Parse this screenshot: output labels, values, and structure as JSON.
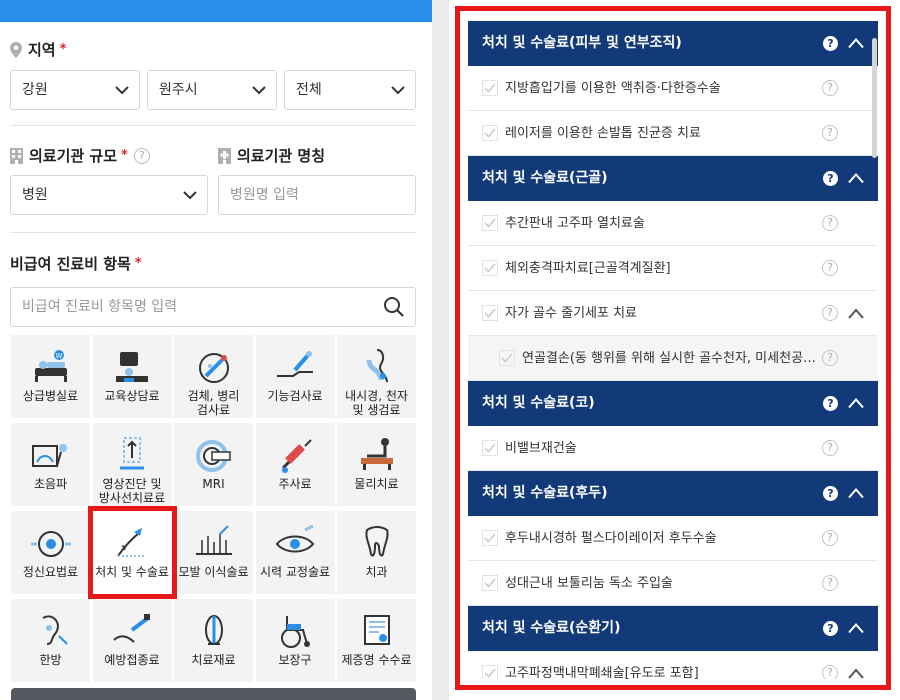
{
  "region": {
    "title": "지역",
    "required_mark": "*",
    "selects": [
      "강원",
      "원주시",
      "전체"
    ]
  },
  "facility": {
    "scale_title": "의료기관 규모",
    "required_mark": "*",
    "scale_value": "병원",
    "name_title": "의료기관 명칭",
    "name_placeholder": "병원명 입력"
  },
  "items": {
    "title": "비급여 진료비 항목",
    "required_mark": "*",
    "search_placeholder": "비급여 진료비 항목명 입력",
    "categories": [
      {
        "label": "상급병실료",
        "icon": "hospital-bed-icon"
      },
      {
        "label": "교육상담료",
        "icon": "consultation-icon"
      },
      {
        "label": "검체, 병리\n검사료",
        "icon": "pathology-test-icon"
      },
      {
        "label": "기능검사료",
        "icon": "function-test-icon"
      },
      {
        "label": "내시경, 천자\n및 생검료",
        "icon": "endoscopy-icon"
      },
      {
        "label": "초음파",
        "icon": "ultrasound-icon"
      },
      {
        "label": "영상진단 및\n방사선치료료",
        "icon": "radiology-icon"
      },
      {
        "label": "MRI",
        "icon": "mri-icon"
      },
      {
        "label": "주사료",
        "icon": "syringe-icon"
      },
      {
        "label": "물리치료",
        "icon": "physical-therapy-icon"
      },
      {
        "label": "정신요법료",
        "icon": "psychotherapy-icon"
      },
      {
        "label": "처치 및 수술료",
        "icon": "surgery-scalpel-icon"
      },
      {
        "label": "모발 이식술료",
        "icon": "hair-transplant-icon"
      },
      {
        "label": "시력 교정술료",
        "icon": "eye-correction-icon"
      },
      {
        "label": "치과",
        "icon": "tooth-icon"
      },
      {
        "label": "한방",
        "icon": "oriental-medicine-icon"
      },
      {
        "label": "예방접종료",
        "icon": "vaccination-icon"
      },
      {
        "label": "치료재료",
        "icon": "treatment-material-icon"
      },
      {
        "label": "보장구",
        "icon": "wheelchair-icon"
      },
      {
        "label": "제증명 수수료",
        "icon": "certificate-icon"
      }
    ],
    "selected_index": 11
  },
  "procedures": {
    "help_symbol": "?",
    "groups": [
      {
        "title": "처치 및 수술료(피부 및 연부조직)",
        "rows": [
          {
            "text": "지방흡입기를 이용한 액취증·다한증수술"
          },
          {
            "text": "레이저를 이용한 손발톱 진균증 치료"
          }
        ]
      },
      {
        "title": "처치 및 수술료(근골)",
        "rows": [
          {
            "text": "추간판내 고주파 열치료술"
          },
          {
            "text": "체외충격파치료[근골격계질환]"
          },
          {
            "text": "자가 골수 줄기세포 치료",
            "expandable": true
          },
          {
            "text": "연골결손(동 행위를 위해 실시한 골수천자, 미세천공술 등 포함)",
            "sub": true
          }
        ]
      },
      {
        "title": "처치 및 수술료(코)",
        "rows": [
          {
            "text": "비밸브재건술"
          }
        ]
      },
      {
        "title": "처치 및 수술료(후두)",
        "rows": [
          {
            "text": "후두내시경하 펄스다이레이저 후두수술"
          },
          {
            "text": "성대근내 보툴리눔 독소 주입술"
          }
        ]
      },
      {
        "title": "처치 및 수술료(순환기)",
        "rows": [
          {
            "text": "고주파정맥내막폐쇄술[유도로 포함]",
            "expandable": true
          }
        ]
      }
    ]
  },
  "colors": {
    "brand_blue": "#2a8fe8",
    "header_navy": "#123a78",
    "highlight_red": "#e81818",
    "required_red": "#e0262b"
  }
}
